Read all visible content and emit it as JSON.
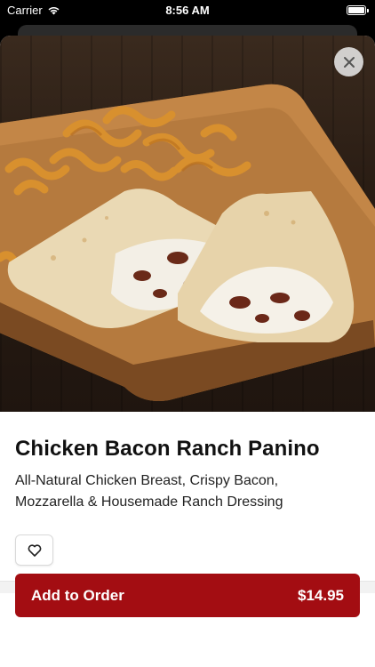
{
  "status_bar": {
    "carrier": "Carrier",
    "time": "8:56 AM"
  },
  "item": {
    "title": "Chicken Bacon Ranch Panino",
    "description": "All-Natural Chicken Breast, Crispy Bacon, Mozzarella & Housemade Ranch Dressing",
    "image_alt": "Chicken bacon ranch panino with curly fries on a wooden board"
  },
  "actions": {
    "add_to_order_label": "Add to Order",
    "price": "$14.95"
  },
  "icons": {
    "close": "close-icon",
    "favorite": "heart-icon",
    "wifi": "wifi-icon",
    "battery": "battery-icon"
  },
  "colors": {
    "accent": "#a30d12",
    "text": "#111111",
    "close_button_bg": "#e6e6e6"
  }
}
